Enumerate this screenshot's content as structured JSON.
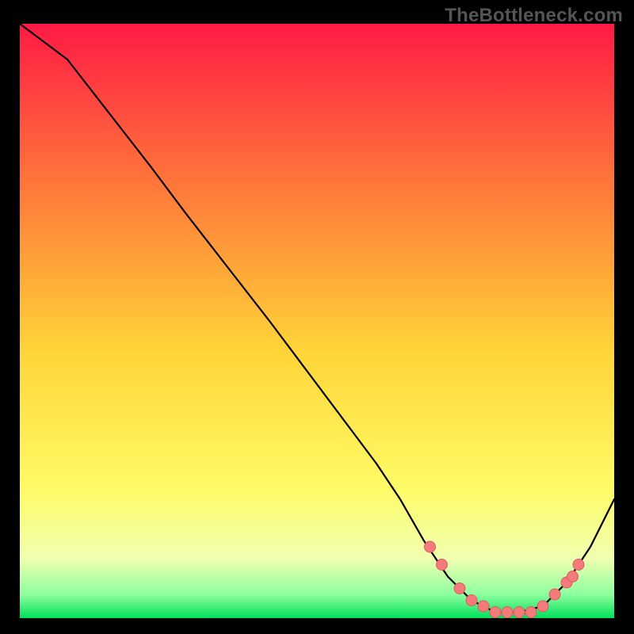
{
  "watermark": "TheBottleneck.com",
  "colors": {
    "gradient_top": "#ff1a45",
    "gradient_mid1": "#ff7a3a",
    "gradient_mid2": "#ffd438",
    "gradient_mid3": "#fffb66",
    "gradient_mid4": "#f0ffb0",
    "gradient_bottom1": "#8effa0",
    "gradient_bottom2": "#00e05a",
    "curve": "#000000",
    "marker_fill": "#f47b7b",
    "marker_stroke": "#e25a5a"
  },
  "chart_data": {
    "type": "line",
    "title": "",
    "xlabel": "",
    "ylabel": "",
    "x_range": [
      0,
      100
    ],
    "y_range": [
      0,
      100
    ],
    "grid": false,
    "legend": false,
    "series": [
      {
        "name": "bottleneck_curve",
        "x": [
          0,
          8,
          15,
          22,
          28,
          35,
          42,
          48,
          54,
          60,
          64,
          68,
          72,
          76,
          80,
          84,
          88,
          92,
          96,
          100
        ],
        "y": [
          100,
          94,
          85,
          76,
          68,
          59,
          50,
          42,
          34,
          26,
          20,
          13,
          7,
          3,
          1,
          1,
          2,
          6,
          12,
          20
        ]
      }
    ],
    "markers": {
      "name": "highlight_points",
      "x": [
        69,
        71,
        74,
        76,
        78,
        80,
        82,
        84,
        86,
        88,
        90,
        92,
        93,
        94
      ],
      "y": [
        12,
        9,
        5,
        3,
        2,
        1,
        1,
        1,
        1,
        2,
        4,
        6,
        7,
        9
      ]
    }
  }
}
